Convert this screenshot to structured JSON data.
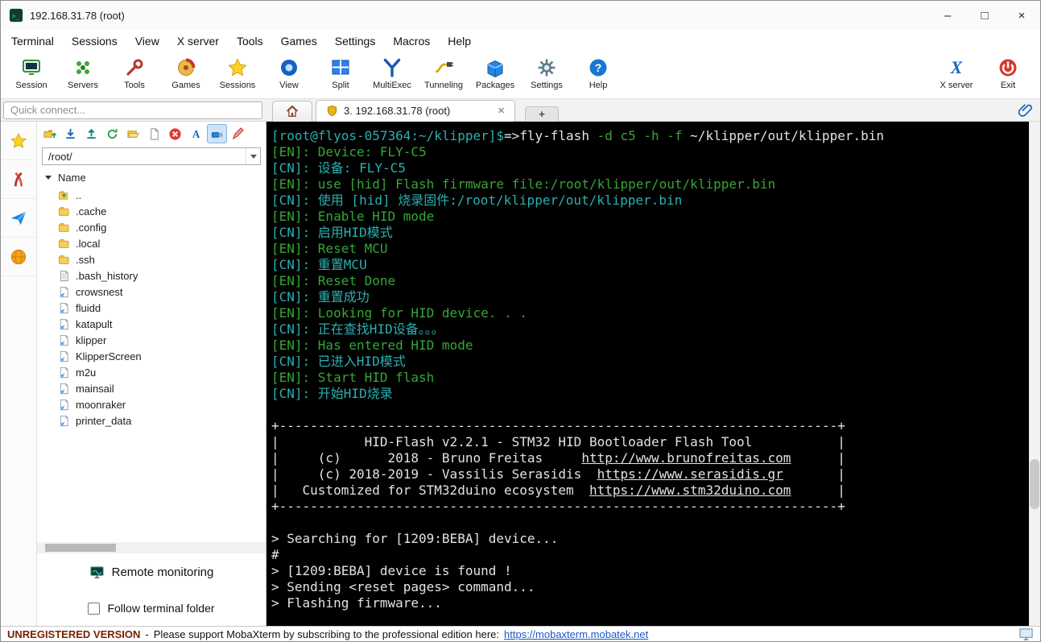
{
  "window": {
    "title": "192.168.31.78 (root)",
    "minimize_glyph": "–",
    "maximize_glyph": "□",
    "close_glyph": "×"
  },
  "menu": [
    "Terminal",
    "Sessions",
    "View",
    "X server",
    "Tools",
    "Games",
    "Settings",
    "Macros",
    "Help"
  ],
  "toolbar": {
    "left": [
      {
        "label": "Session",
        "icon": "session-icon"
      },
      {
        "label": "Servers",
        "icon": "servers-icon"
      },
      {
        "label": "Tools",
        "icon": "tools-icon"
      },
      {
        "label": "Games",
        "icon": "games-icon"
      },
      {
        "label": "Sessions",
        "icon": "sessions-star-icon"
      },
      {
        "label": "View",
        "icon": "view-icon"
      },
      {
        "label": "Split",
        "icon": "split-icon"
      },
      {
        "label": "MultiExec",
        "icon": "multiexec-icon"
      },
      {
        "label": "Tunneling",
        "icon": "tunneling-icon"
      },
      {
        "label": "Packages",
        "icon": "packages-icon"
      },
      {
        "label": "Settings",
        "icon": "settings-icon"
      },
      {
        "label": "Help",
        "icon": "help-icon"
      }
    ],
    "right": [
      {
        "label": "X server",
        "icon": "xserver-icon"
      },
      {
        "label": "Exit",
        "icon": "exit-icon"
      }
    ]
  },
  "quick_connect_placeholder": "Quick connect...",
  "tabs": {
    "active_label": "3. 192.168.31.78 (root)",
    "close_glyph": "×",
    "new_tab_glyph": "+"
  },
  "activity_bar": [
    {
      "name": "sessions-panel-button",
      "icon": "star-small-icon"
    },
    {
      "name": "tools-panel-button",
      "icon": "ribbon-icon"
    },
    {
      "name": "macros-panel-button",
      "icon": "plane-icon"
    },
    {
      "name": "network-panel-button",
      "icon": "globe-icon"
    }
  ],
  "sidebar": {
    "toolbar": [
      {
        "icon": "parent-folder-icon",
        "selected": false
      },
      {
        "icon": "download-icon",
        "selected": false
      },
      {
        "icon": "upload-icon",
        "selected": false
      },
      {
        "icon": "refresh-icon",
        "selected": false
      },
      {
        "icon": "open-folder-icon",
        "selected": false
      },
      {
        "icon": "new-file-icon",
        "selected": false
      },
      {
        "icon": "abort-icon",
        "selected": false
      },
      {
        "icon": "ascii-mode-icon",
        "selected": false
      },
      {
        "icon": "binary-mode-icon",
        "selected": true
      },
      {
        "icon": "edit-icon",
        "selected": false
      }
    ],
    "path_value": "/root/",
    "tree_header": "Name",
    "items": [
      {
        "name": "..",
        "type": "up"
      },
      {
        "name": ".cache",
        "type": "folder"
      },
      {
        "name": ".config",
        "type": "folder"
      },
      {
        "name": ".local",
        "type": "folder"
      },
      {
        "name": ".ssh",
        "type": "folder"
      },
      {
        "name": ".bash_history",
        "type": "file"
      },
      {
        "name": "crowsnest",
        "type": "link"
      },
      {
        "name": "fluidd",
        "type": "link"
      },
      {
        "name": "katapult",
        "type": "link"
      },
      {
        "name": "klipper",
        "type": "link"
      },
      {
        "name": "KlipperScreen",
        "type": "link"
      },
      {
        "name": "m2u",
        "type": "link"
      },
      {
        "name": "mainsail",
        "type": "link"
      },
      {
        "name": "moonraker",
        "type": "link"
      },
      {
        "name": "printer_data",
        "type": "link"
      }
    ],
    "remote_monitoring_label": "Remote monitoring",
    "follow_terminal_label": "Follow terminal folder",
    "follow_checked": false
  },
  "terminal": {
    "lines": [
      [
        {
          "t": "[root@flyos-057364:~/klipper]$",
          "c": "p"
        },
        {
          "t": "=>",
          "c": "w"
        },
        {
          "t": "fly-flash ",
          "c": "w"
        },
        {
          "t": "-d c5 -h -f ",
          "c": "g"
        },
        {
          "t": "~/klipper/out/klipper.bin",
          "c": "w"
        }
      ],
      [
        {
          "t": "[EN]: Device: FLY-C5",
          "c": "g"
        }
      ],
      [
        {
          "t": "[CN]: 设备: FLY-C5",
          "c": "c"
        }
      ],
      [
        {
          "t": "[EN]: use [hid] Flash firmware file:/root/klipper/out/klipper.bin",
          "c": "g"
        }
      ],
      [
        {
          "t": "[CN]: 使用 [hid] 烧录固件:/root/klipper/out/klipper.bin",
          "c": "c"
        }
      ],
      [
        {
          "t": "[EN]: Enable HID mode",
          "c": "g"
        }
      ],
      [
        {
          "t": "[CN]: 启用HID模式",
          "c": "c"
        }
      ],
      [
        {
          "t": "[EN]: Reset MCU",
          "c": "g"
        }
      ],
      [
        {
          "t": "[CN]: 重置MCU",
          "c": "c"
        }
      ],
      [
        {
          "t": "[EN]: Reset Done",
          "c": "g"
        }
      ],
      [
        {
          "t": "[CN]: 重置成功",
          "c": "c"
        }
      ],
      [
        {
          "t": "[EN]: Looking for HID device. . .",
          "c": "g"
        }
      ],
      [
        {
          "t": "[CN]: 正在查找HID设备。。。",
          "c": "c"
        }
      ],
      [
        {
          "t": "[EN]: Has entered HID mode",
          "c": "g"
        }
      ],
      [
        {
          "t": "[CN]: 已进入HID模式",
          "c": "c"
        }
      ],
      [
        {
          "t": "[EN]: Start HID flash",
          "c": "g"
        }
      ],
      [
        {
          "t": "[CN]: 开始HID烧录",
          "c": "c"
        }
      ],
      [],
      [
        {
          "t": "+------------------------------------------------------------------------+",
          "c": "w"
        }
      ],
      [
        {
          "t": "|           HID-Flash v2.2.1 - STM32 HID Bootloader Flash Tool           |",
          "c": "w"
        }
      ],
      [
        {
          "t": "|     (c)      2018 - Bruno Freitas     ",
          "c": "w"
        },
        {
          "t": "http://www.brunofreitas.com",
          "c": "u"
        },
        {
          "t": "      |",
          "c": "w"
        }
      ],
      [
        {
          "t": "|     (c) 2018-2019 - Vassilis Serasidis  ",
          "c": "w"
        },
        {
          "t": "https://www.serasidis.gr",
          "c": "u"
        },
        {
          "t": "       |",
          "c": "w"
        }
      ],
      [
        {
          "t": "|   Customized for STM32duino ecosystem  ",
          "c": "w"
        },
        {
          "t": "https://www.stm32duino.com",
          "c": "u"
        },
        {
          "t": "      |",
          "c": "w"
        }
      ],
      [
        {
          "t": "+------------------------------------------------------------------------+",
          "c": "w"
        }
      ],
      [],
      [
        {
          "t": "> Searching for [1209:BEBA] device...",
          "c": "w"
        }
      ],
      [
        {
          "t": "#",
          "c": "w"
        }
      ],
      [
        {
          "t": "> [1209:BEBA] device is found !",
          "c": "w"
        }
      ],
      [
        {
          "t": "> Sending <reset pages> command...",
          "c": "w"
        }
      ],
      [
        {
          "t": "> Flashing firmware...",
          "c": "w"
        }
      ]
    ]
  },
  "statusbar": {
    "unregistered": "UNREGISTERED VERSION",
    "separator": "-",
    "message": "Please support MobaXterm by subscribing to the professional edition here:",
    "link": "https://mobaxterm.mobatek.net"
  },
  "colors": {
    "terminal_bg": "#000000",
    "terminal_green": "#35a635",
    "terminal_cyan": "#2bb0b0",
    "terminal_white": "#e2e2e2",
    "status_link_blue": "#1a58c8",
    "unregistered_red": "#7a1f00"
  }
}
